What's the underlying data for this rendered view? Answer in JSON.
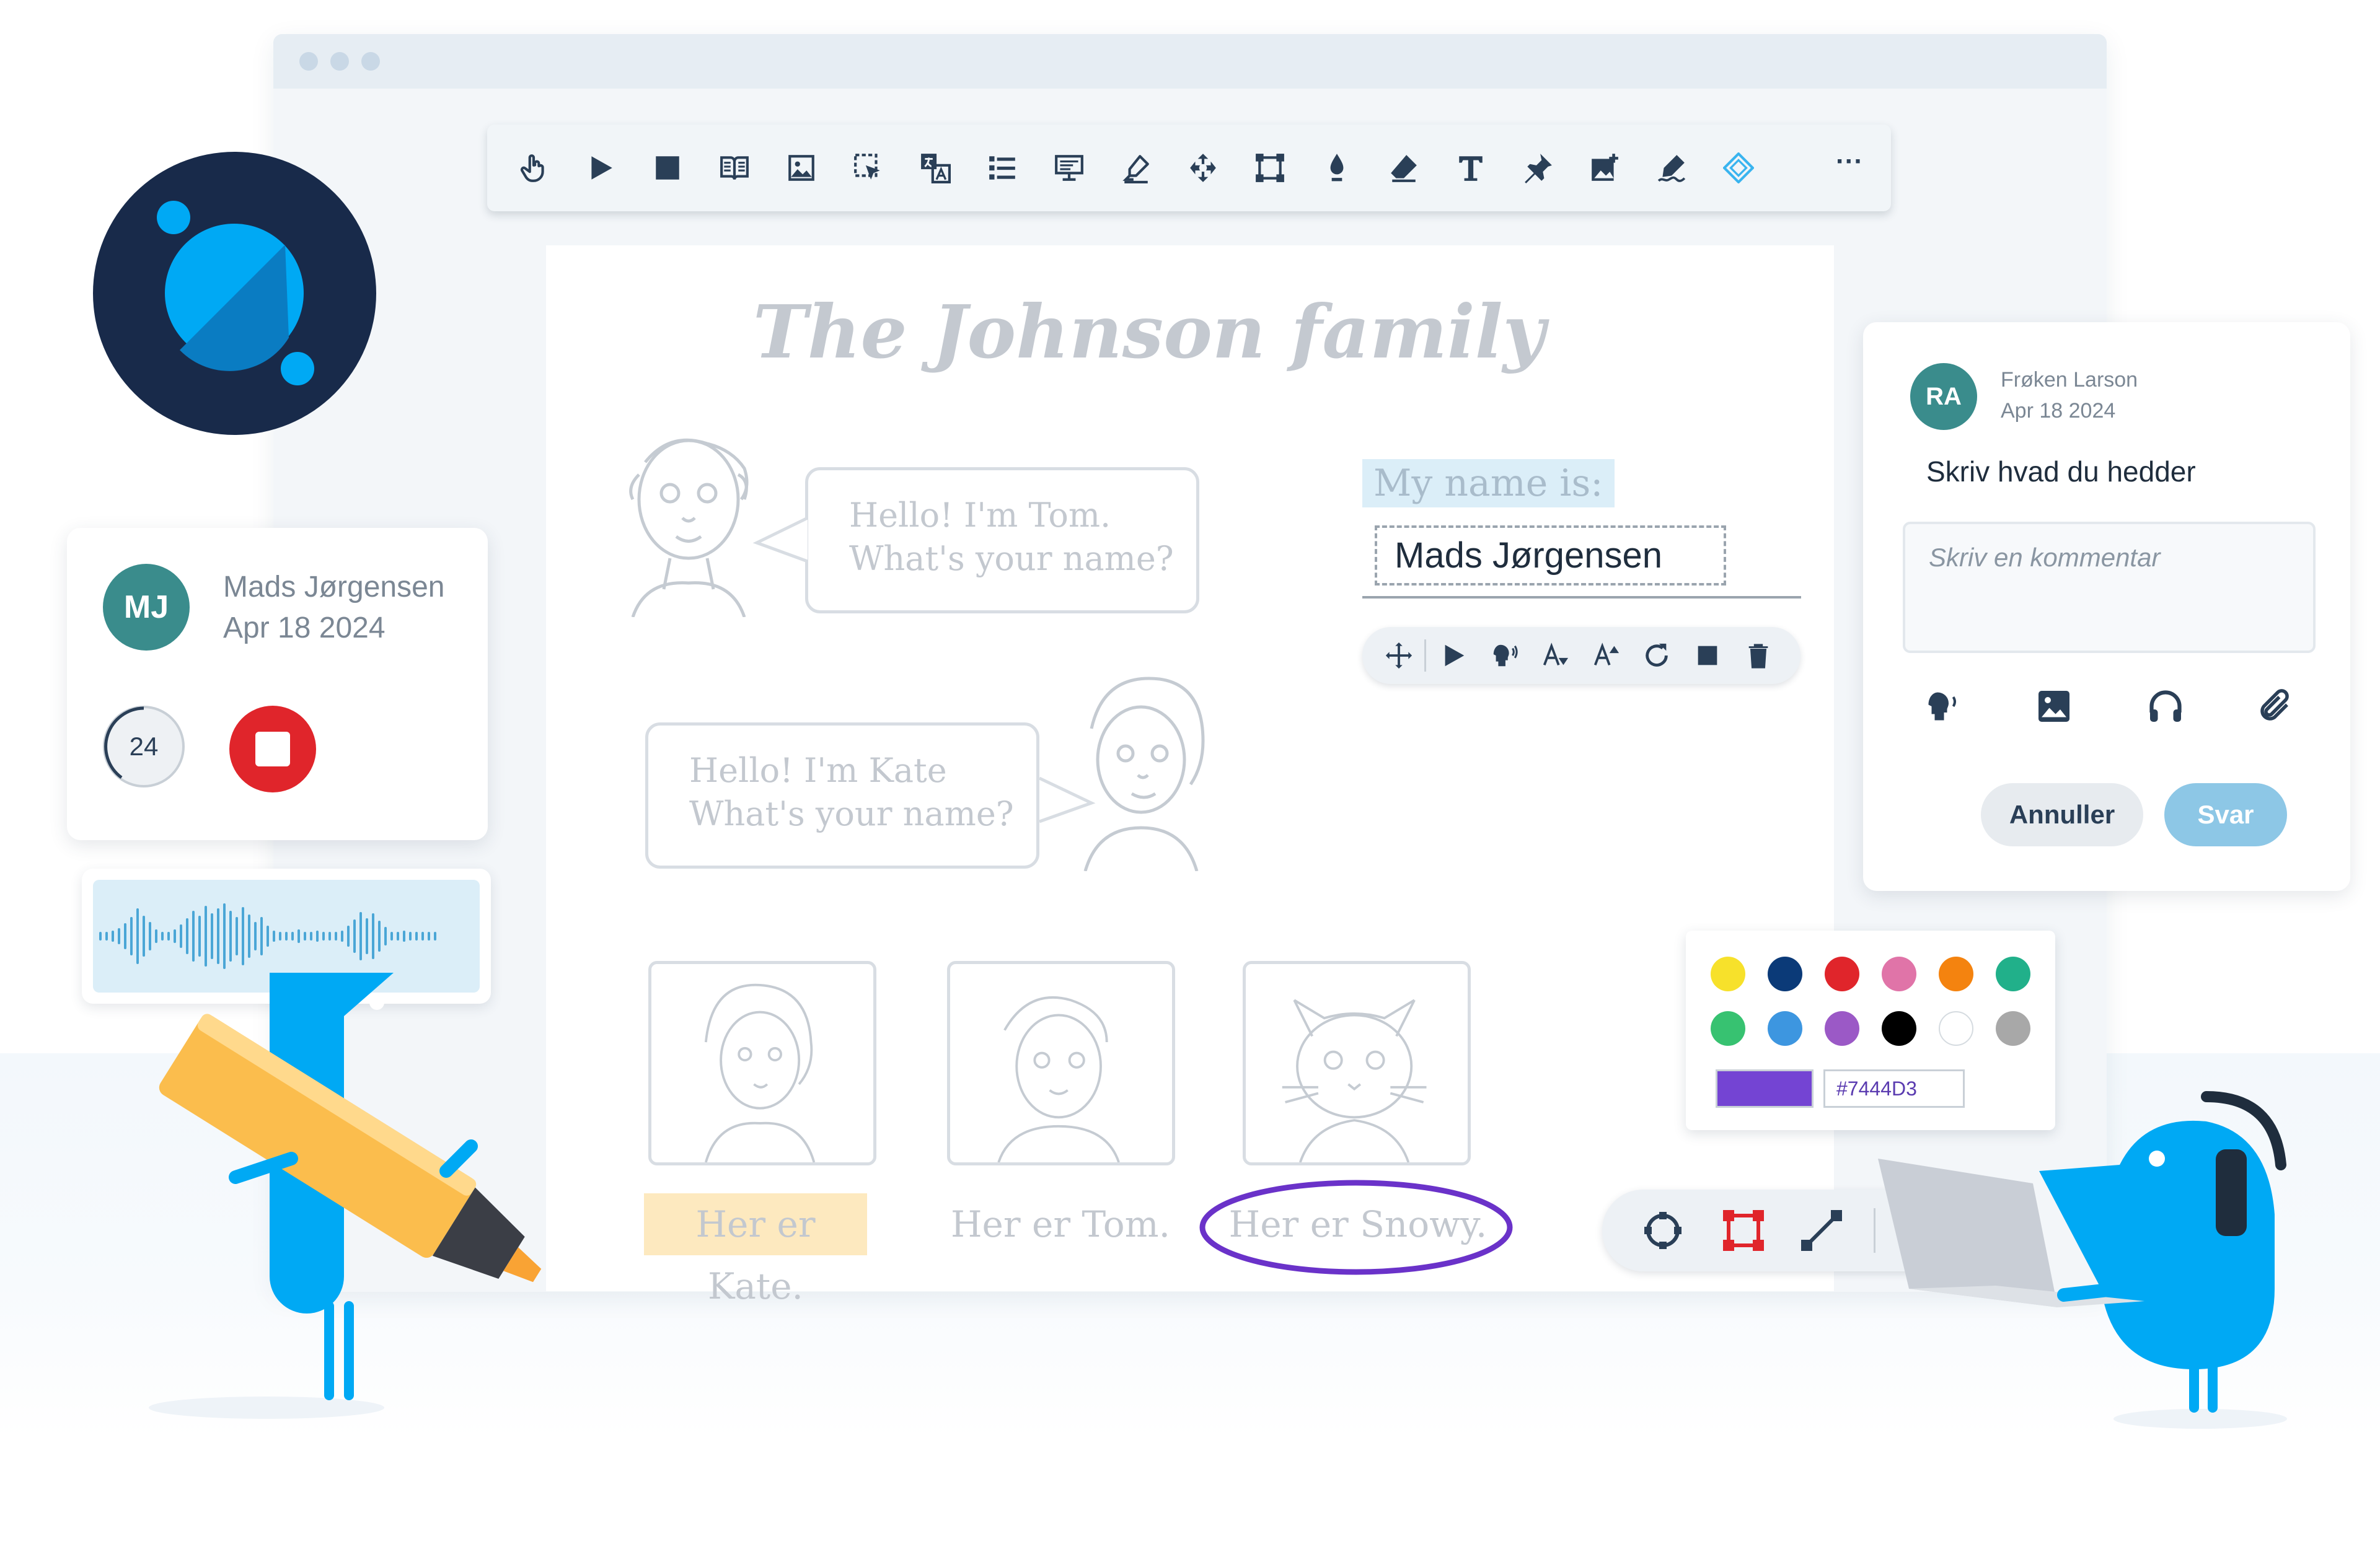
{
  "toolbar": {
    "icons": [
      "hand-pointer-icon",
      "play-icon",
      "stop-icon",
      "book-icon",
      "image-icon",
      "select-icon",
      "translate-icon",
      "list-icon",
      "presentation-icon",
      "highlighter-icon",
      "move-icon",
      "frame-icon",
      "ink-icon",
      "eraser-icon",
      "text-icon",
      "pin-icon",
      "add-image-icon",
      "signature-icon",
      "shape-icon",
      "more-icon"
    ],
    "more_label": "···"
  },
  "document": {
    "title": "The Johnson family",
    "tom_bubble": [
      "Hello! I'm Tom.",
      "What's your name?"
    ],
    "kate_bubble": [
      "Hello! I'm Kate",
      "What's your name?"
    ],
    "name_label": "My name is:",
    "name_value": "Mads Jørgensen",
    "captions": [
      "Her er Kate.",
      "Her er Tom.",
      "Her er Snowy."
    ]
  },
  "recorder": {
    "initials": "MJ",
    "user": "Mads Jørgensen",
    "date": "Apr 18 2024",
    "count": "24"
  },
  "comment": {
    "initials": "RA",
    "author": "Frøken Larson",
    "date": "Apr 18 2024",
    "prompt": "Skriv hvad du hedder",
    "input_placeholder": "Skriv en kommentar",
    "cancel_label": "Annuller",
    "reply_label": "Svar"
  },
  "palette": {
    "colors": [
      "#f7e12b",
      "#0b3a78",
      "#e0252b",
      "#e074a8",
      "#f4830f",
      "#21b08a",
      "#37c271",
      "#3d96e0",
      "#9b59c6",
      "#000000",
      "#ffffff",
      "#a8a8a8"
    ],
    "selected_color": "#7444d3",
    "hex_value": "#7444D3"
  },
  "colors": {
    "accent_blue": "#00a9f4",
    "logo_bg": "#182a4a",
    "avatar_teal": "#3a8c8c",
    "record_red": "#e0252b",
    "highlight_yellow": "#fde9bf",
    "circle_purple": "#6a32c9"
  }
}
